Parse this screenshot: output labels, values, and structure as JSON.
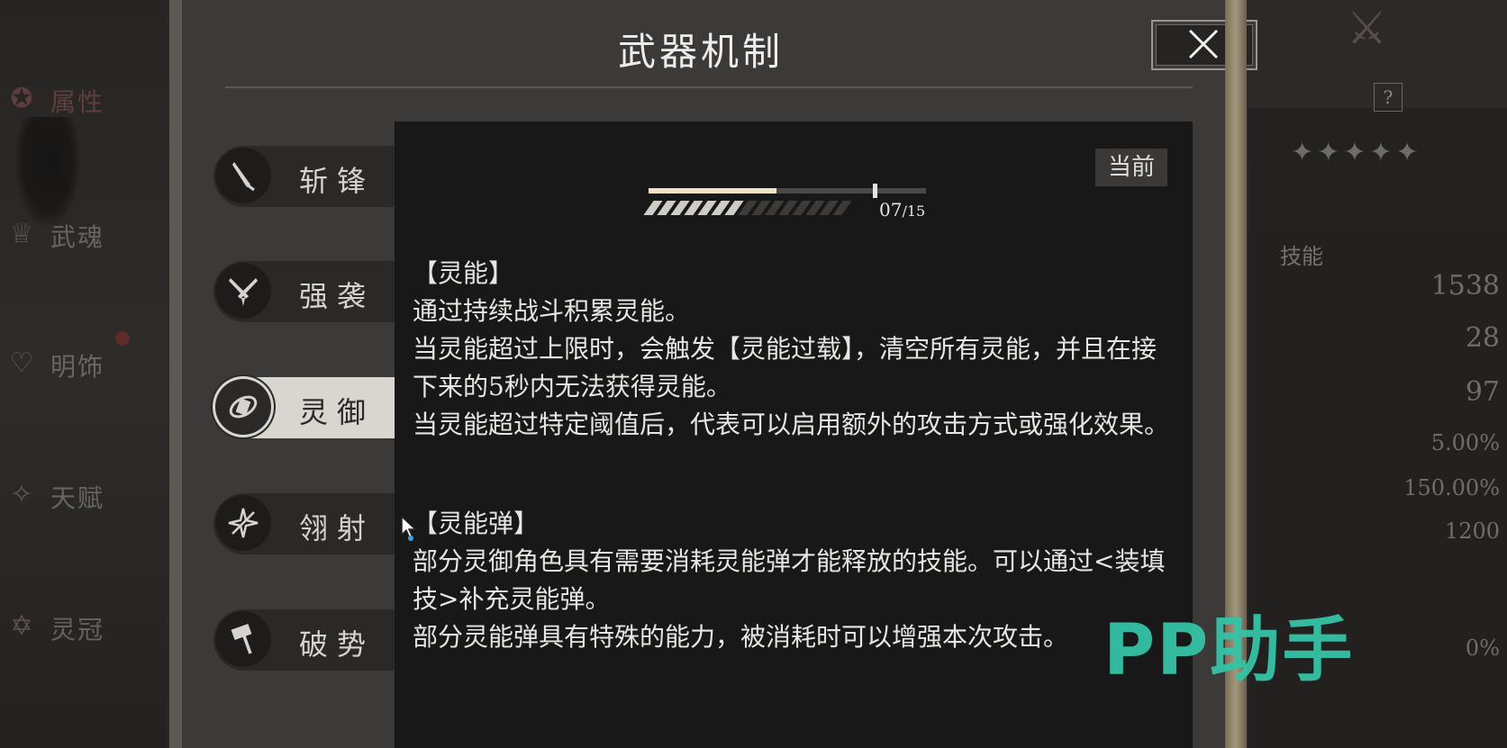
{
  "dialog": {
    "title": "武器机制",
    "current_badge": "当前"
  },
  "tabs": [
    {
      "label": "斩锋",
      "icon": "blade-icon",
      "active": false
    },
    {
      "label": "强袭",
      "icon": "crossed-blades-icon",
      "active": false
    },
    {
      "label": "灵御",
      "icon": "spirit-orb-icon",
      "active": true
    },
    {
      "label": "翎射",
      "icon": "arrow-star-icon",
      "active": false
    },
    {
      "label": "破势",
      "icon": "hammer-icon",
      "active": false
    }
  ],
  "gauge": {
    "current": "07",
    "max": "/15",
    "pips_filled": 7,
    "pips_total": 15,
    "fill_fraction": 0.46,
    "threshold_fraction": 0.81
  },
  "sections": [
    {
      "header": "【灵能】",
      "lines": [
        "通过持续战斗积累灵能。",
        "当灵能超过上限时，会触发【灵能过载】，清空所有灵能，并且在接下来的5秒内无法获得灵能。",
        "当灵能超过特定阈值后，代表可以启用额外的攻击方式或强化效果。"
      ]
    },
    {
      "header": "【灵能弹】",
      "lines": [
        "部分灵御角色具有需要消耗灵能弹才能释放的技能。可以通过<装填技>补充灵能弹。",
        "部分灵能弹具有特殊的能力，被消耗时可以增强本次攻击。"
      ]
    }
  ],
  "background": {
    "left_nav": [
      "属性",
      "武魂",
      "明饰",
      "天赋",
      "灵冠"
    ],
    "skill_header": "技能",
    "stats": [
      "1538",
      "28",
      "97",
      "5.00%",
      "150.00%",
      "1200",
      "0%"
    ],
    "help": "?"
  },
  "watermark": "PP助手",
  "colors": {
    "accent_teal": "#35c3a6",
    "gauge_fill": "#efe3c6",
    "active_tab": "#d9d5cf"
  }
}
